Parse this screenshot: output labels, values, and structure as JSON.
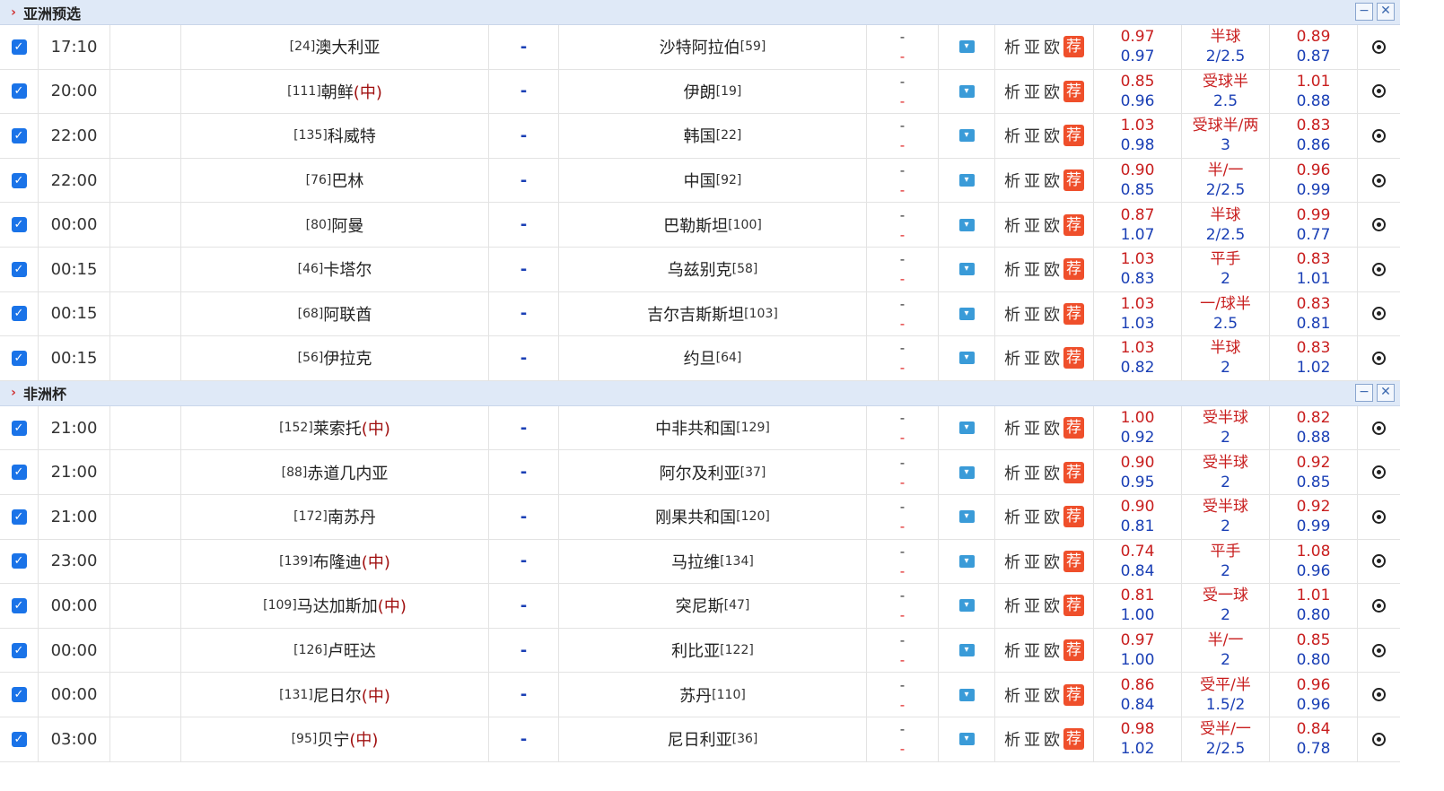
{
  "leagues": [
    {
      "name": "亚洲预选",
      "matches": [
        {
          "time": "17:10",
          "home_rank": "[24]",
          "home": "澳大利亚",
          "home_neutral": "",
          "away": "沙特阿拉伯",
          "away_rank": "[59]",
          "o1": "0.97",
          "o2": "0.97",
          "line1": "半球",
          "line2": "2/2.5",
          "p1": "0.89",
          "p2": "0.87"
        },
        {
          "time": "20:00",
          "home_rank": "[111]",
          "home": "朝鲜",
          "home_neutral": "(中)",
          "away": "伊朗",
          "away_rank": "[19]",
          "o1": "0.85",
          "o2": "0.96",
          "line1": "受球半",
          "line2": "2.5",
          "p1": "1.01",
          "p2": "0.88"
        },
        {
          "time": "22:00",
          "home_rank": "[135]",
          "home": "科威特",
          "home_neutral": "",
          "away": "韩国",
          "away_rank": "[22]",
          "o1": "1.03",
          "o2": "0.98",
          "line1": "受球半/两",
          "line2": "3",
          "p1": "0.83",
          "p2": "0.86"
        },
        {
          "time": "22:00",
          "home_rank": "[76]",
          "home": "巴林",
          "home_neutral": "",
          "away": "中国",
          "away_rank": "[92]",
          "o1": "0.90",
          "o2": "0.85",
          "line1": "半/一",
          "line2": "2/2.5",
          "p1": "0.96",
          "p2": "0.99"
        },
        {
          "time": "00:00",
          "home_rank": "[80]",
          "home": "阿曼",
          "home_neutral": "",
          "away": "巴勒斯坦",
          "away_rank": "[100]",
          "o1": "0.87",
          "o2": "1.07",
          "line1": "半球",
          "line2": "2/2.5",
          "p1": "0.99",
          "p2": "0.77"
        },
        {
          "time": "00:15",
          "home_rank": "[46]",
          "home": "卡塔尔",
          "home_neutral": "",
          "away": "乌兹别克",
          "away_rank": "[58]",
          "o1": "1.03",
          "o2": "0.83",
          "line1": "平手",
          "line2": "2",
          "p1": "0.83",
          "p2": "1.01"
        },
        {
          "time": "00:15",
          "home_rank": "[68]",
          "home": "阿联酋",
          "home_neutral": "",
          "away": "吉尔吉斯斯坦",
          "away_rank": "[103]",
          "o1": "1.03",
          "o2": "1.03",
          "line1": "一/球半",
          "line2": "2.5",
          "p1": "0.83",
          "p2": "0.81"
        },
        {
          "time": "00:15",
          "home_rank": "[56]",
          "home": "伊拉克",
          "home_neutral": "",
          "away": "约旦",
          "away_rank": "[64]",
          "o1": "1.03",
          "o2": "0.82",
          "line1": "半球",
          "line2": "2",
          "p1": "0.83",
          "p2": "1.02"
        }
      ]
    },
    {
      "name": "非洲杯",
      "matches": [
        {
          "time": "21:00",
          "home_rank": "[152]",
          "home": "莱索托",
          "home_neutral": "(中)",
          "away": "中非共和国",
          "away_rank": "[129]",
          "o1": "1.00",
          "o2": "0.92",
          "line1": "受半球",
          "line2": "2",
          "p1": "0.82",
          "p2": "0.88"
        },
        {
          "time": "21:00",
          "home_rank": "[88]",
          "home": "赤道几内亚",
          "home_neutral": "",
          "away": "阿尔及利亚",
          "away_rank": "[37]",
          "o1": "0.90",
          "o2": "0.95",
          "line1": "受半球",
          "line2": "2",
          "p1": "0.92",
          "p2": "0.85"
        },
        {
          "time": "21:00",
          "home_rank": "[172]",
          "home": "南苏丹",
          "home_neutral": "",
          "away": "刚果共和国",
          "away_rank": "[120]",
          "o1": "0.90",
          "o2": "0.81",
          "line1": "受半球",
          "line2": "2",
          "p1": "0.92",
          "p2": "0.99"
        },
        {
          "time": "23:00",
          "home_rank": "[139]",
          "home": "布隆迪",
          "home_neutral": "(中)",
          "away": "马拉维",
          "away_rank": "[134]",
          "o1": "0.74",
          "o2": "0.84",
          "line1": "平手",
          "line2": "2",
          "p1": "1.08",
          "p2": "0.96"
        },
        {
          "time": "00:00",
          "home_rank": "[109]",
          "home": "马达加斯加",
          "home_neutral": "(中)",
          "away": "突尼斯",
          "away_rank": "[47]",
          "o1": "0.81",
          "o2": "1.00",
          "line1": "受一球",
          "line2": "2",
          "p1": "1.01",
          "p2": "0.80"
        },
        {
          "time": "00:00",
          "home_rank": "[126]",
          "home": "卢旺达",
          "home_neutral": "",
          "away": "利比亚",
          "away_rank": "[122]",
          "o1": "0.97",
          "o2": "1.00",
          "line1": "半/一",
          "line2": "2",
          "p1": "0.85",
          "p2": "0.80"
        },
        {
          "time": "00:00",
          "home_rank": "[131]",
          "home": "尼日尔",
          "home_neutral": "(中)",
          "away": "苏丹",
          "away_rank": "[110]",
          "o1": "0.86",
          "o2": "0.84",
          "line1": "受平/半",
          "line2": "1.5/2",
          "p1": "0.96",
          "p2": "0.96"
        },
        {
          "time": "03:00",
          "home_rank": "[95]",
          "home": "贝宁",
          "home_neutral": "(中)",
          "away": "尼日利亚",
          "away_rank": "[36]",
          "o1": "0.98",
          "o2": "1.02",
          "line1": "受半/一",
          "line2": "2/2.5",
          "p1": "0.84",
          "p2": "0.78"
        }
      ]
    }
  ],
  "labels": {
    "score": "-",
    "half1": "-",
    "half2": "-",
    "analysis": "析",
    "asia": "亚",
    "euro": "欧",
    "recommend": "荐",
    "collapse": "−",
    "close": "✕",
    "chevron": "›",
    "check": "✓",
    "tv": "▾"
  },
  "icons": {
    "league_toggle": "chevron-right-icon",
    "row_check": "checkbox-icon",
    "tv": "tv-dropdown-icon",
    "ball": "football-icon"
  }
}
